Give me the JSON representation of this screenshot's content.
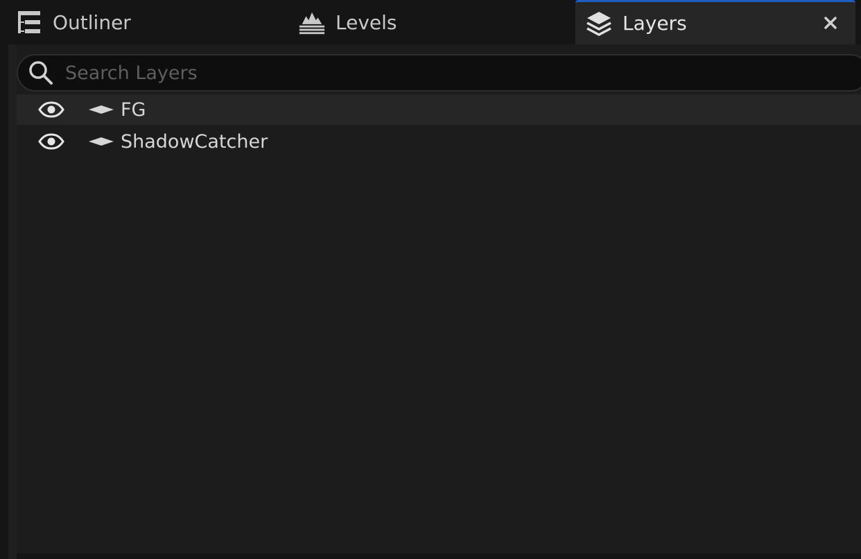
{
  "tabs": [
    {
      "label": "Outliner",
      "icon": "outliner-icon",
      "active": false
    },
    {
      "label": "Levels",
      "icon": "levels-icon",
      "active": false
    },
    {
      "label": "Layers",
      "icon": "layers-icon",
      "active": true
    }
  ],
  "search": {
    "placeholder": "Search Layers",
    "value": ""
  },
  "layers": [
    {
      "name": "FG",
      "visible": true,
      "highlighted": true
    },
    {
      "name": "ShadowCatcher",
      "visible": true,
      "highlighted": false
    }
  ],
  "colors": {
    "background": "#151515",
    "panel": "#1c1c1c",
    "active_tab": "#262626",
    "accent": "#1f5fc4",
    "text": "#d6d6d6",
    "placeholder": "#5e5e5e"
  }
}
